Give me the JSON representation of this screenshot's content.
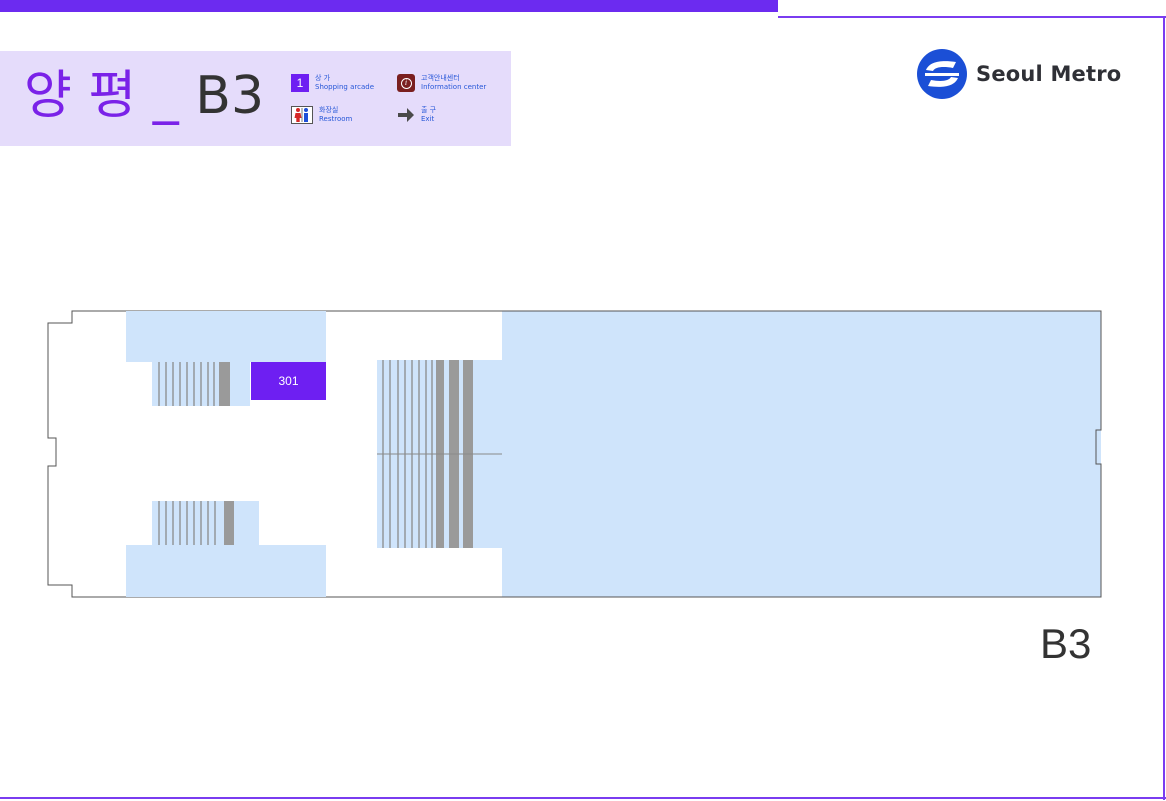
{
  "station": {
    "name": "양 평",
    "separator": "_",
    "floor": "B3"
  },
  "legend": {
    "shopping": {
      "number": "1",
      "ko": "상 가",
      "en": "Shopping arcade",
      "icon": "shop-number-icon"
    },
    "information": {
      "ko": "고객안내센터",
      "en": "Information center",
      "icon": "info-icon"
    },
    "restroom": {
      "ko": "화장실",
      "en": "Restroom",
      "icon": "restroom-icon"
    },
    "exit": {
      "ko": "출 구",
      "en": "Exit",
      "icon": "arrow-right-icon"
    }
  },
  "brand": {
    "name": "Seoul Metro",
    "icon": "seoul-metro-logo"
  },
  "map": {
    "units": [
      {
        "label": "301"
      }
    ],
    "floor_label": "B3"
  },
  "colors": {
    "accent": "#6c2bf0",
    "header_bg": "#e5dcfb",
    "area_fill": "#cfe4fb",
    "unit_fill": "#6e1ff2",
    "stair_gray": "#9a9a9a"
  }
}
